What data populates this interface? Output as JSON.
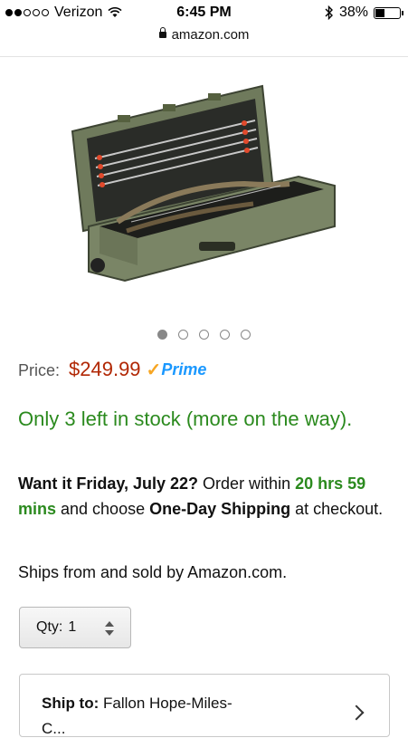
{
  "status_bar": {
    "carrier": "Verizon",
    "time": "6:45 PM",
    "battery": "38%"
  },
  "url": "amazon.com",
  "carousel": {
    "count": 5,
    "active": 1
  },
  "price": {
    "label": "Price:",
    "value": "$249.99",
    "prime": "Prime"
  },
  "stock_text": "Only 3 left in stock (more on the way).",
  "delivery": {
    "prefix": "Want it Friday, July 22?",
    "order_within": " Order within ",
    "time_left": "20 hrs 59 mins",
    "choose": " and choose ",
    "method": "One-Day Shipping",
    "suffix": " at checkout."
  },
  "ships_from": "Ships from and sold by Amazon.com.",
  "quantity": {
    "label": "Qty:",
    "value": "1"
  },
  "ship_to": {
    "label": "Ship to:",
    "name": "Fallon Hope-Miles-",
    "name_cont": "C..."
  }
}
